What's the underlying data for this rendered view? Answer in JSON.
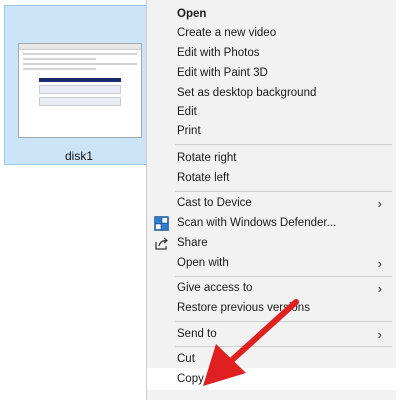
{
  "file": {
    "name": "disk1"
  },
  "context_menu": {
    "items": [
      {
        "label": "Open"
      },
      {
        "label": "Create a new video"
      },
      {
        "label": "Edit with Photos"
      },
      {
        "label": "Edit with Paint 3D"
      },
      {
        "label": "Set as desktop background"
      },
      {
        "label": "Edit"
      },
      {
        "label": "Print"
      },
      {
        "label": "Rotate right"
      },
      {
        "label": "Rotate left"
      },
      {
        "label": "Cast to Device"
      },
      {
        "label": "Scan with Windows Defender..."
      },
      {
        "label": "Share"
      },
      {
        "label": "Open with"
      },
      {
        "label": "Give access to"
      },
      {
        "label": "Restore previous versions"
      },
      {
        "label": "Send to"
      },
      {
        "label": "Cut"
      },
      {
        "label": "Copy"
      }
    ],
    "submenu_arrow": "›"
  },
  "annotation": {
    "arrow_color": "#e02020"
  }
}
